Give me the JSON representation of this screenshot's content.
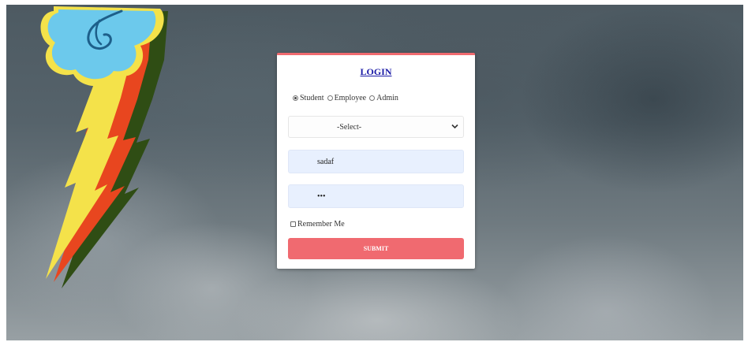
{
  "login": {
    "title": "LOGIN",
    "roles": [
      {
        "label": "Student",
        "selected": true
      },
      {
        "label": "Employee",
        "selected": false
      },
      {
        "label": "Admin",
        "selected": false
      }
    ],
    "select": {
      "value": "-Select-"
    },
    "username": {
      "value": "sadaf"
    },
    "password": {
      "value": "•••"
    },
    "remember_label": "Remember Me",
    "submit_label": "SUBMIT"
  },
  "colors": {
    "accent": "#f06a70",
    "title_link": "#1a1aa6",
    "field_bg": "#e8f0fe"
  },
  "icons": {
    "background_graphic": "lightning-bolt-cutie-mark",
    "select_arrow": "chevron-down-icon"
  }
}
